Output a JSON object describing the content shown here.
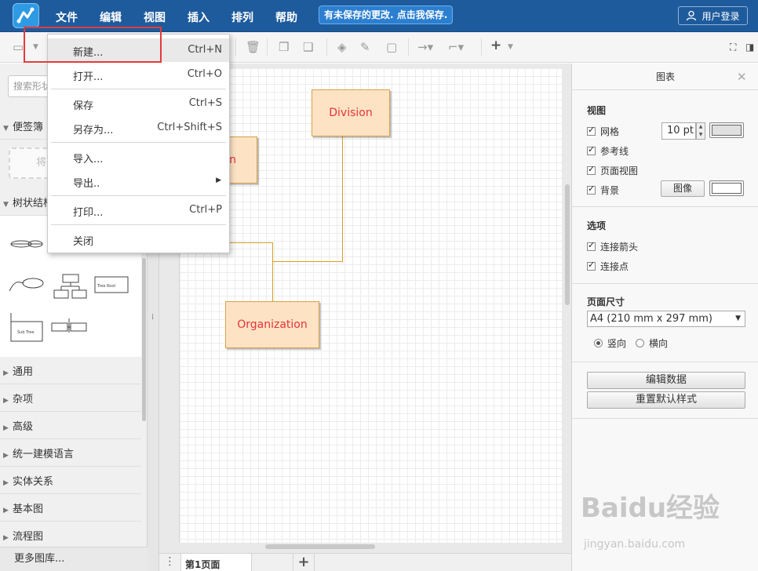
{
  "menubar": {
    "items": [
      "文件",
      "编辑",
      "视图",
      "插入",
      "排列",
      "帮助"
    ],
    "save_banner": "有未保存的更改. 点击我保存.",
    "login": "用户登录"
  },
  "sidebar": {
    "search_placeholder": "搜索形状",
    "scratchpad": {
      "label": "便签簿",
      "drop_hint": "将"
    },
    "tree_section": "树状结构",
    "shape_labels": {
      "sub_tree": "Sub Tree",
      "tree_root": "Tree Root"
    },
    "sections": [
      "通用",
      "杂项",
      "高级",
      "统一建模语言",
      "实体关系",
      "基本图",
      "流程图"
    ],
    "more_libraries": "更多图库..."
  },
  "file_menu": {
    "items": [
      {
        "label": "新建...",
        "shortcut": "Ctrl+N"
      },
      {
        "label": "打开...",
        "shortcut": "Ctrl+O"
      },
      {
        "label": "保存",
        "shortcut": "Ctrl+S"
      },
      {
        "label": "另存为...",
        "shortcut": "Ctrl+Shift+S"
      },
      {
        "label": "导入...",
        "shortcut": ""
      },
      {
        "label": "导出..",
        "shortcut": ""
      },
      {
        "label": "打印...",
        "shortcut": "Ctrl+P"
      },
      {
        "label": "关闭",
        "shortcut": ""
      }
    ]
  },
  "canvas": {
    "nodes": {
      "division": "Division",
      "partial": "n",
      "organization": "Organization"
    }
  },
  "page_tabs": {
    "page1": "第1页面"
  },
  "format_panel": {
    "title": "图表",
    "view_heading": "视图",
    "grid": "网格",
    "grid_size": "10 pt",
    "guides": "参考线",
    "page_view": "页面视图",
    "background": "背景",
    "image_button": "图像",
    "options_heading": "选项",
    "connection_arrows": "连接箭头",
    "connection_points": "连接点",
    "page_size_heading": "页面尺寸",
    "page_size": "A4 (210 mm x 297 mm)",
    "portrait": "竖向",
    "landscape": "横向",
    "edit_data": "编辑数据",
    "reset_style": "重置默认样式"
  },
  "colors": {
    "menubar": "#1e5b9c",
    "node_fill": "#fde3c4",
    "node_text": "#e8323a",
    "highlight_box": "#e53a3a"
  },
  "watermark": {
    "brand": "Baidu经验",
    "url": "jingyan.baidu.com"
  }
}
